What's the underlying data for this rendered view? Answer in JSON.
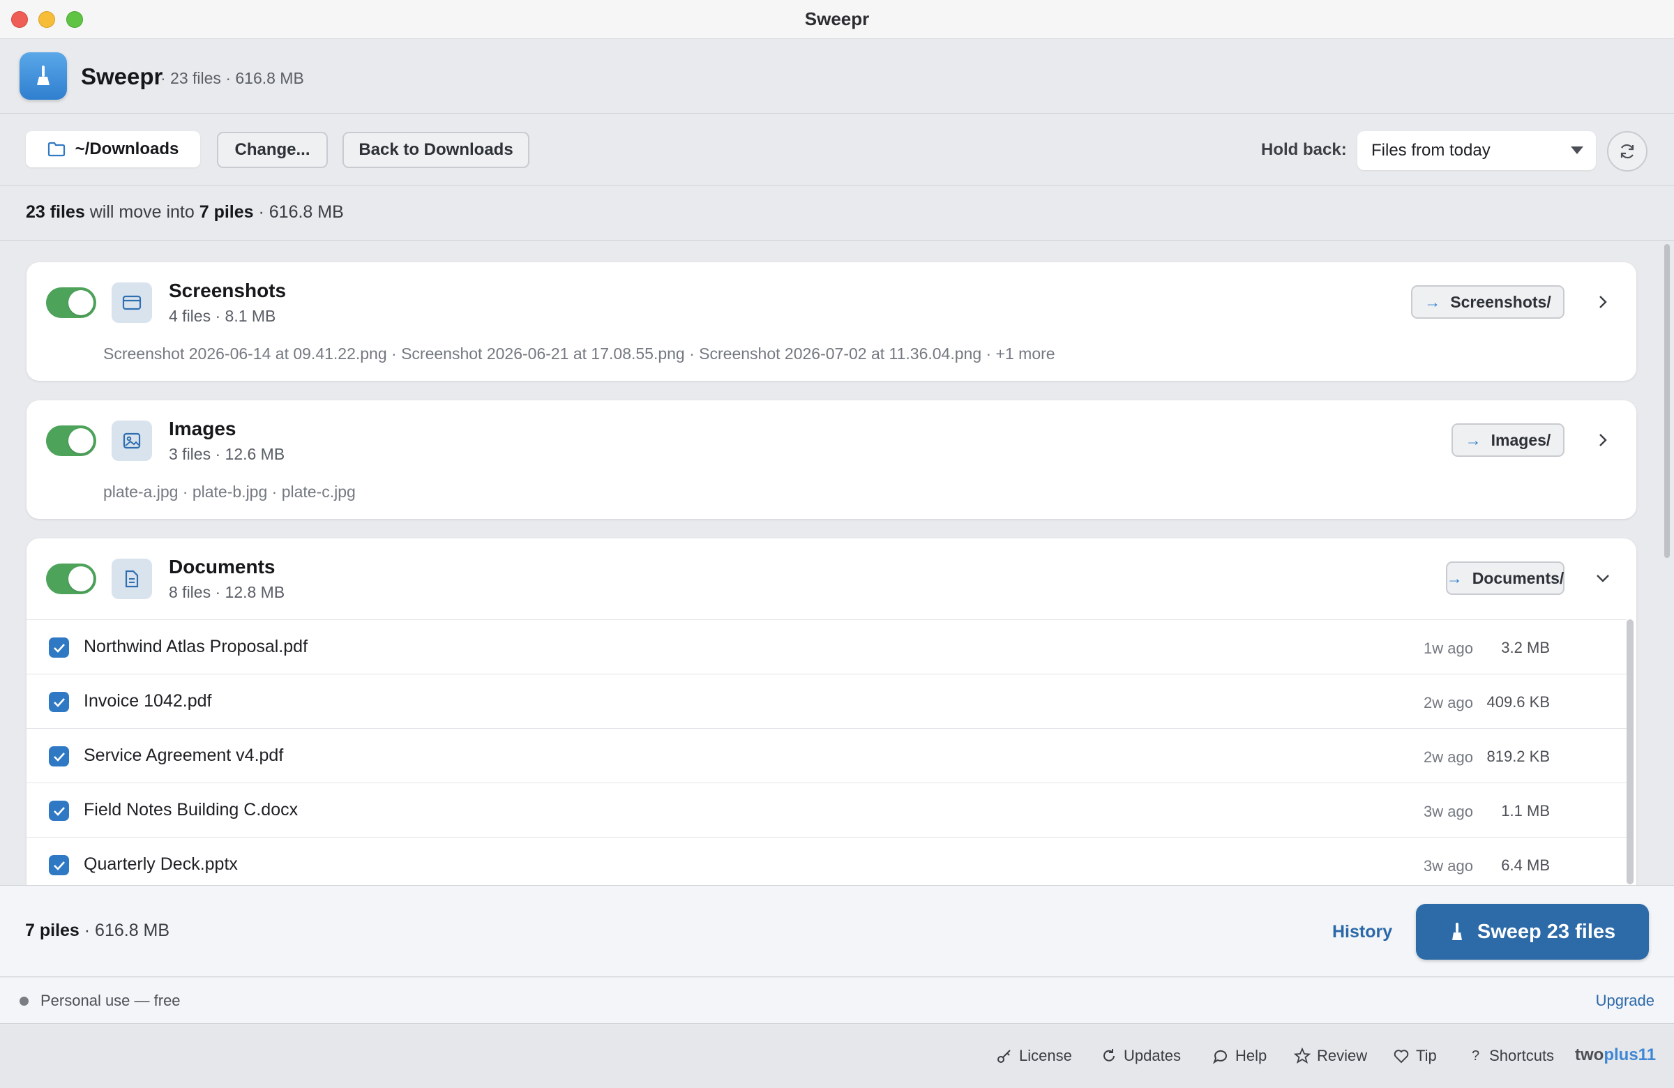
{
  "window": {
    "title": "Sweepr"
  },
  "header": {
    "app_name": "Sweepr",
    "meta": "· 23 files · 616.8 MB"
  },
  "toolbar": {
    "path_label": "~/Downloads",
    "change_label": "Change...",
    "back_label": "Back to Downloads",
    "hold_back_label": "Hold back:",
    "hold_back_value": "Files from today"
  },
  "summary": {
    "files": "23 files",
    "mid": " will move into ",
    "piles": "7 piles",
    "size": " · 616.8 MB"
  },
  "categories": [
    {
      "name": "Screenshots",
      "meta": "4 files · 8.1 MB",
      "destination": "Screenshots/",
      "files_preview": "Screenshot 2026-06-14 at 09.41.22.png · Screenshot 2026-06-21 at 17.08.55.png · Screenshot 2026-07-02 at 11.36.04.png · +1 more",
      "icon": "window-icon",
      "enabled": true
    },
    {
      "name": "Images",
      "meta": "3 files · 12.6 MB",
      "destination": "Images/",
      "files_preview": "plate-a.jpg · plate-b.jpg · plate-c.jpg",
      "icon": "image-icon",
      "enabled": true
    },
    {
      "name": "Documents",
      "meta": "8 files · 12.8 MB",
      "destination": "Documents/",
      "icon": "document-icon",
      "enabled": true,
      "files": [
        {
          "name": "Northwind Atlas Proposal.pdf",
          "age": "1w ago",
          "size": "3.2 MB"
        },
        {
          "name": "Invoice 1042.pdf",
          "age": "2w ago",
          "size": "409.6 KB"
        },
        {
          "name": "Service Agreement v4.pdf",
          "age": "2w ago",
          "size": "819.2 KB"
        },
        {
          "name": "Field Notes Building C.docx",
          "age": "3w ago",
          "size": "1.1 MB"
        },
        {
          "name": "Quarterly Deck.pptx",
          "age": "3w ago",
          "size": "6.4 MB"
        }
      ]
    }
  ],
  "bottom": {
    "piles": "7 piles",
    "size": " · 616.8 MB",
    "history_label": "History",
    "sweep_label": "Sweep 23 files"
  },
  "license": {
    "text": "Personal use — free",
    "upgrade_label": "Upgrade"
  },
  "footer": {
    "links": [
      "License",
      "Updates",
      "Help",
      "Review",
      "Tip",
      "Shortcuts"
    ],
    "brand_a": "two",
    "brand_b": "plus11"
  },
  "colors": {
    "accent": "#2c6aa8",
    "toggle_on": "#4da35a",
    "checkbox": "#2f79c4"
  }
}
